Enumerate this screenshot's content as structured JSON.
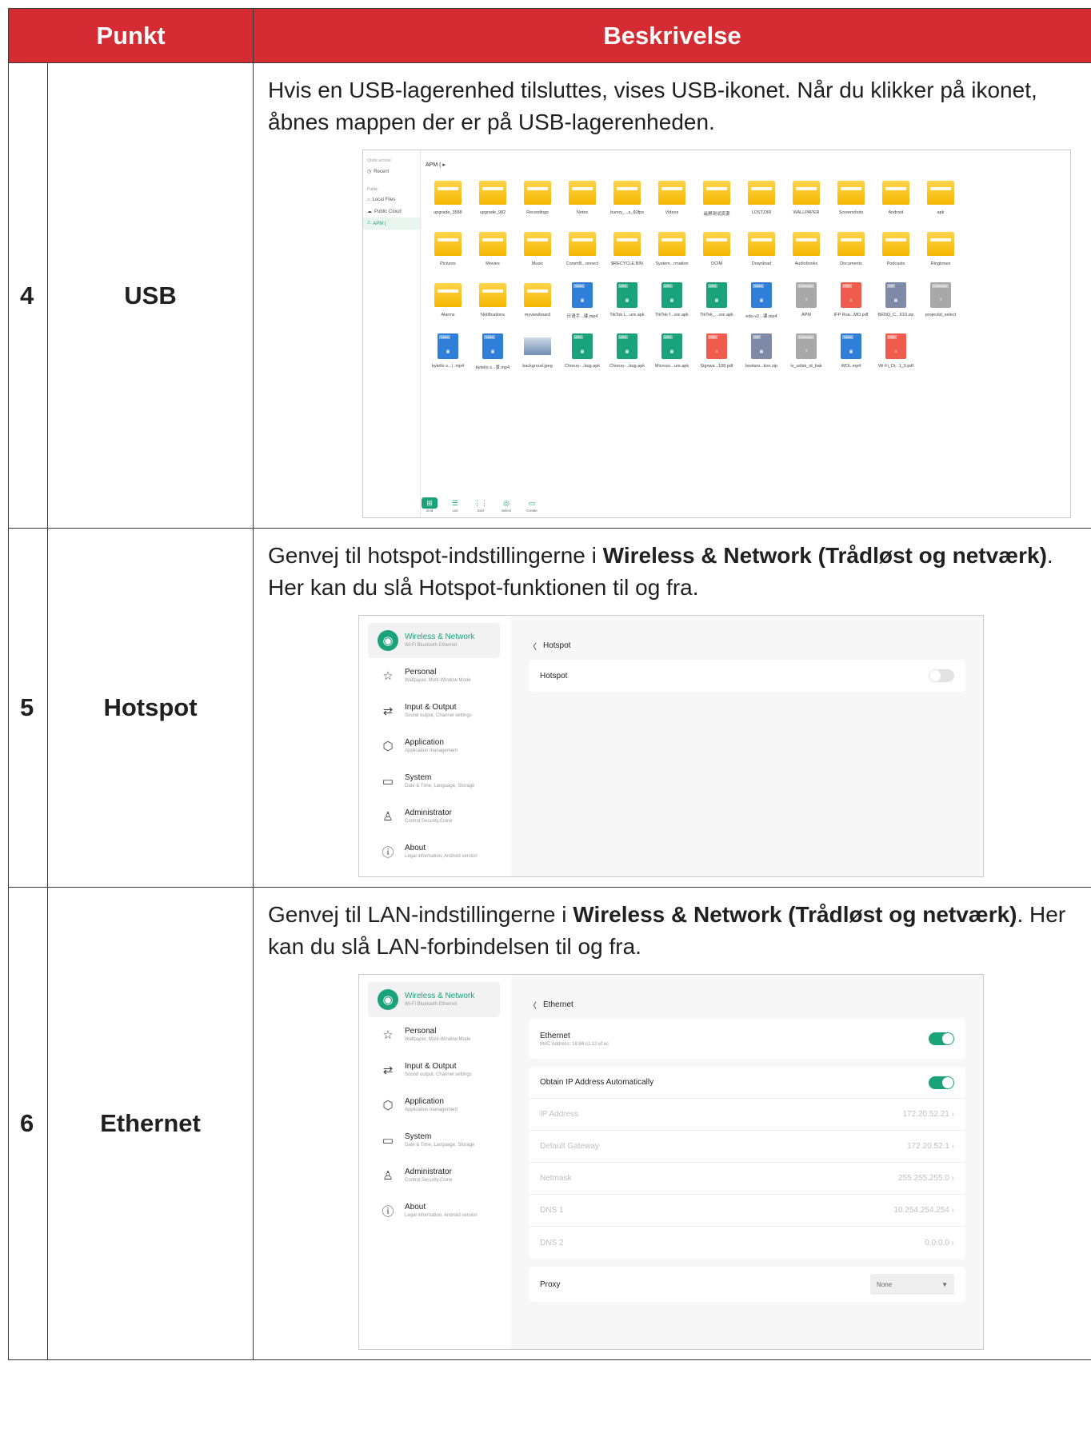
{
  "headers": {
    "item": "Punkt",
    "desc": "Beskrivelse"
  },
  "rows": [
    {
      "num": "4",
      "name": "USB",
      "text": "Hvis en USB-lagerenhed tilsluttes, vises USB-ikonet. Når du klikker på ikonet, åbnes mappen der er på USB-lagerenheden."
    },
    {
      "num": "5",
      "name": "Hotspot",
      "text_pre": "Genvej til hotspot-indstillingerne i ",
      "text_bold": "Wireless & Network (Trådløst og netværk)",
      "text_post": ". Her kan du slå Hotspot-funktionen til og fra."
    },
    {
      "num": "6",
      "name": "Ethernet",
      "text_pre": "Genvej til LAN-indstillingerne i ",
      "text_bold": "Wireless & Network (Trådløst og netværk)",
      "text_post": ". Her kan du slå LAN-forbindelsen til og fra."
    }
  ],
  "fm": {
    "quick_access": "Quick access",
    "recent": "Recent",
    "public": "Public",
    "local": "Local Files",
    "cloud": "Public Cloud",
    "apm": "APM  (",
    "crumb": "APM  ( ▸",
    "items": [
      {
        "kind": "folder",
        "label": "upgrade_3588"
      },
      {
        "kind": "folder",
        "label": "upgrade_982"
      },
      {
        "kind": "folder",
        "label": "Recordings"
      },
      {
        "kind": "folder",
        "label": "Notes"
      },
      {
        "kind": "folder",
        "label": "bunny_...s_60fps"
      },
      {
        "kind": "folder",
        "label": "Videos"
      },
      {
        "kind": "folder",
        "label": "遥屏测试资源"
      },
      {
        "kind": "folder",
        "label": "LOST.DIR"
      },
      {
        "kind": "folder",
        "label": "WALLPAPER"
      },
      {
        "kind": "folder",
        "label": "Screenshots"
      },
      {
        "kind": "folder",
        "label": "Android"
      },
      {
        "kind": "folder",
        "label": "apk"
      },
      {
        "kind": "folder",
        "label": "Pictures"
      },
      {
        "kind": "folder",
        "label": "Movies"
      },
      {
        "kind": "folder",
        "label": "Music"
      },
      {
        "kind": "folder",
        "label": "CommB...onnect"
      },
      {
        "kind": "folder",
        "label": "$RECYCLE.BIN"
      },
      {
        "kind": "folder",
        "label": "System...rmation"
      },
      {
        "kind": "folder",
        "label": "DCIM"
      },
      {
        "kind": "folder",
        "label": "Download"
      },
      {
        "kind": "folder",
        "label": "Audiobooks"
      },
      {
        "kind": "folder",
        "label": "Documents"
      },
      {
        "kind": "folder",
        "label": "Podcasts"
      },
      {
        "kind": "folder",
        "label": "Ringtones"
      },
      {
        "kind": "folder",
        "label": "Alarms"
      },
      {
        "kind": "folder",
        "label": "Notifications"
      },
      {
        "kind": "folder",
        "label": "myviewboard"
      },
      {
        "kind": "video",
        "label": "日语手...课.mp4"
      },
      {
        "kind": "apk",
        "label": "TikTok L...ure.apk"
      },
      {
        "kind": "apk",
        "label": "TikTok f...ure.apk"
      },
      {
        "kind": "apk",
        "label": "TikTok_...ure.apk"
      },
      {
        "kind": "video",
        "label": "edu-v2...课.mp4"
      },
      {
        "kind": "unknown",
        "label": "APM"
      },
      {
        "kind": "pdf",
        "label": "IFP Roa...MO.pdf"
      },
      {
        "kind": "zip",
        "label": "BENQ_C...610.zip"
      },
      {
        "kind": "unknown",
        "label": "projectid_select"
      },
      {
        "kind": "video",
        "label": "bytello s...) .mp4"
      },
      {
        "kind": "video",
        "label": "bytello s...景.mp4"
      },
      {
        "kind": "image",
        "label": "backgroud.jpeg"
      },
      {
        "kind": "apk",
        "label": "Choruo-...bug.apk"
      },
      {
        "kind": "apk",
        "label": "Choruo-...bug.apk"
      },
      {
        "kind": "apk",
        "label": "Microso...ure.apk"
      },
      {
        "kind": "pdf",
        "label": "Signwa...108.pdf"
      },
      {
        "kind": "zip",
        "label": "bootani...tion.zip"
      },
      {
        "kind": "unknown",
        "label": "lv_udisk_id_bak"
      },
      {
        "kind": "video",
        "label": "WOL.mp4"
      },
      {
        "kind": "pdf",
        "label": "Wi-Fi_Di...1_0.pdf"
      }
    ],
    "tags": {
      "video": "Video",
      "apk": "APK",
      "pdf": "PDF",
      "zip": "ZIP",
      "unknown": "Unknown"
    },
    "colors": {
      "video": "#2f7fd9",
      "apk": "#1aa37a",
      "pdf": "#ef5b4c",
      "zip": "#7e8aa8",
      "unknown": "#a8a8a8"
    },
    "toolbar": [
      "Grid",
      "List",
      "Sort",
      "Select",
      "Create"
    ]
  },
  "settings_menu": [
    {
      "title": "Wireless & Network",
      "sub": "Wi-Fi Bluetooth Ethernet",
      "icon": "wifi-icon"
    },
    {
      "title": "Personal",
      "sub": "Wallpaper, Multi-Window Mode",
      "icon": "star-icon"
    },
    {
      "title": "Input & Output",
      "sub": "Sound output, Channel settings",
      "icon": "arrows-icon"
    },
    {
      "title": "Application",
      "sub": "Application management",
      "icon": "cube-icon"
    },
    {
      "title": "System",
      "sub": "Date & Time, Language, Storage",
      "icon": "monitor-icon"
    },
    {
      "title": "Administrator",
      "sub": "Control,Security,Clone",
      "icon": "user-icon"
    },
    {
      "title": "About",
      "sub": "Legal information, Android version",
      "icon": "info-icon"
    }
  ],
  "hotspot": {
    "back": "Hotspot",
    "row": "Hotspot",
    "toggle": "off"
  },
  "ethernet": {
    "back": "Ethernet",
    "eth_title": "Ethernet",
    "eth_mac": "MAC Address: 18:84:c1:12:ef:ec",
    "eth_toggle": "on",
    "auto_ip": "Obtain IP Address Automatically",
    "auto_toggle": "on",
    "fields": [
      {
        "label": "IP Address",
        "value": "172.20.52.21"
      },
      {
        "label": "Default Gateway",
        "value": "172.20.52.1"
      },
      {
        "label": "Netmask",
        "value": "255.255.255.0"
      },
      {
        "label": "DNS 1",
        "value": "10.254.254.254"
      },
      {
        "label": "DNS 2",
        "value": "0.0.0.0"
      }
    ],
    "proxy": "Proxy",
    "proxy_value": "None"
  }
}
